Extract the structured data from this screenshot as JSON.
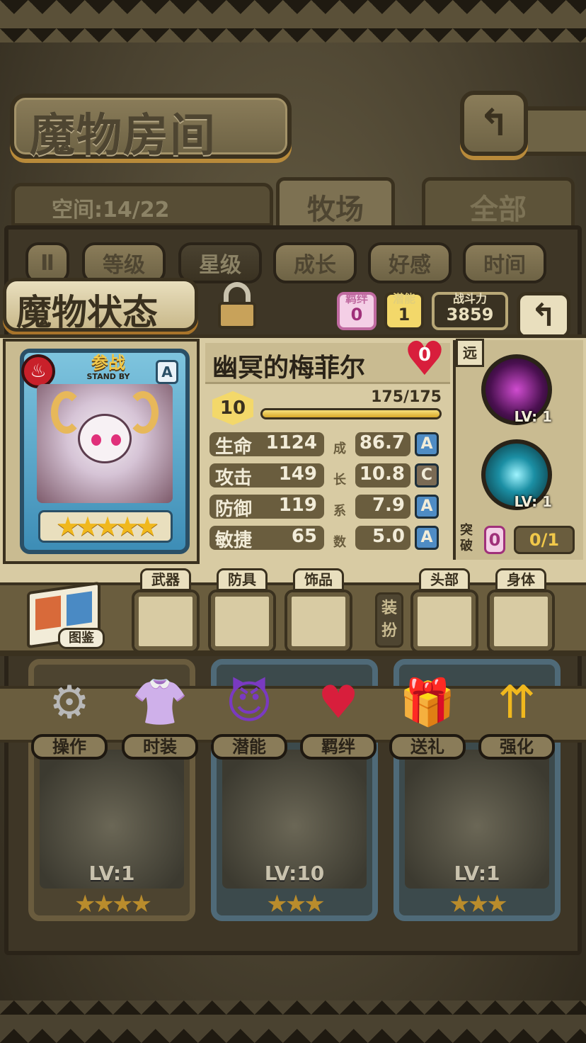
{
  "header": {
    "title": "魔物房间",
    "back_icon": "↰"
  },
  "room": {
    "space_label": "空间:14/22",
    "tabs": [
      "牧场",
      "全部"
    ]
  },
  "filters": {
    "pause_icon": "Ⅱ",
    "buttons": [
      "等级",
      "星级",
      "成长",
      "好感",
      "时间"
    ],
    "active": "星级"
  },
  "status": {
    "title": "魔物状态",
    "bond_label": "羁绊",
    "bond_value": "0",
    "potential_label": "潜能",
    "potential_value": "1",
    "power_label": "战斗力",
    "power_value": "3859",
    "return_icon": "↰"
  },
  "monster": {
    "name": "幽冥的梅菲尔",
    "affection": "0",
    "level": "10",
    "exp": "175/175",
    "exp_fraction": 1.0,
    "standby_zh": "参战",
    "standby_en": "STAND BY",
    "rank": "A",
    "stars": "★★★★★",
    "element_icon": "fire-icon",
    "stats": [
      {
        "name": "生命",
        "value": "1124",
        "growth": "86.7",
        "grade": "A"
      },
      {
        "name": "攻击",
        "value": "149",
        "growth": "10.8",
        "grade": "C"
      },
      {
        "name": "防御",
        "value": "119",
        "growth": "7.9",
        "grade": "A"
      },
      {
        "name": "敏捷",
        "value": "65",
        "growth": "5.0",
        "grade": "A"
      }
    ],
    "growth_label": [
      "成",
      "长",
      "系",
      "数"
    ]
  },
  "skills": {
    "range_tag": "远",
    "items": [
      {
        "level": "LV: 1"
      },
      {
        "level": "LV: 1"
      }
    ],
    "break_label": "突破",
    "break_value": "0",
    "break_progress": "0/1"
  },
  "equipment": {
    "codex_label": "图鉴",
    "slots_left": [
      "武器",
      "防具",
      "饰品"
    ],
    "dress_label": "装扮",
    "slots_right": [
      "头部",
      "身体"
    ]
  },
  "actions": [
    {
      "label": "操作",
      "icon": "gear-icon"
    },
    {
      "label": "时装",
      "icon": "clothes-icon"
    },
    {
      "label": "潜能",
      "icon": "demon-icon"
    },
    {
      "label": "羁绊",
      "icon": "hearts-icon"
    },
    {
      "label": "送礼",
      "icon": "gift-icon"
    },
    {
      "label": "强化",
      "icon": "arrows-up-icon"
    }
  ],
  "roster": [
    {
      "level": "LV:1",
      "stars": "★★★★",
      "frame": "bronze"
    },
    {
      "level": "LV:10",
      "stars": "★★★",
      "frame": "blue"
    },
    {
      "level": "LV:1",
      "stars": "★★★",
      "frame": "blue"
    }
  ]
}
